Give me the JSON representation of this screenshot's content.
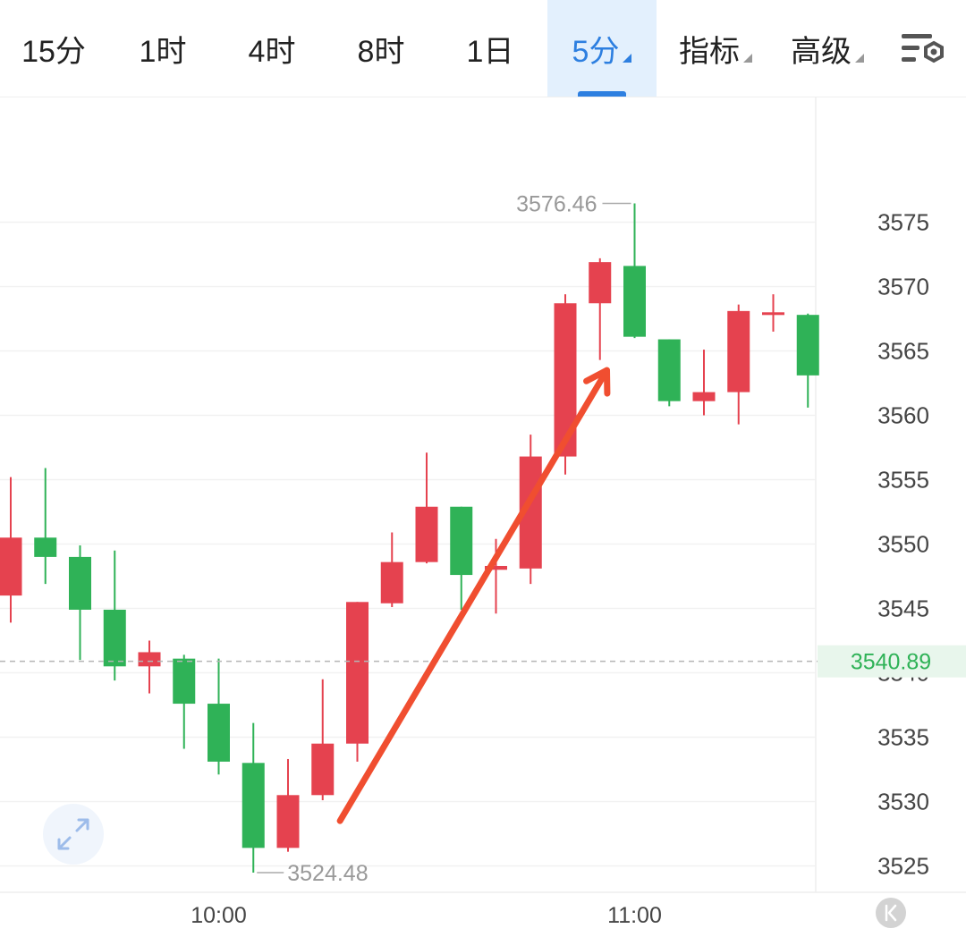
{
  "toolbar": {
    "tabs": [
      {
        "label": "15分",
        "active": false,
        "dropdown": false
      },
      {
        "label": "1时",
        "active": false,
        "dropdown": false
      },
      {
        "label": "4时",
        "active": false,
        "dropdown": false
      },
      {
        "label": "8时",
        "active": false,
        "dropdown": false
      },
      {
        "label": "1日",
        "active": false,
        "dropdown": false
      },
      {
        "label": "5分",
        "active": true,
        "dropdown": true
      },
      {
        "label": "指标",
        "active": false,
        "dropdown": true
      },
      {
        "label": "高级",
        "active": false,
        "dropdown": true
      }
    ],
    "settings_icon": "chart-settings-icon"
  },
  "colors": {
    "up": "#e5424f",
    "down": "#2fb257",
    "accent": "#2d7fe0",
    "current_price": "#2fb257",
    "arrow": "#f04e30"
  },
  "chart_data": {
    "type": "candlestick",
    "interval": "5分",
    "y_ticks": [
      3525,
      3530,
      3535,
      3540,
      3545,
      3550,
      3555,
      3560,
      3565,
      3570,
      3575
    ],
    "ylim": [
      3523,
      3578
    ],
    "x_labels": [
      {
        "index": 6,
        "label": "10:00"
      },
      {
        "index": 18,
        "label": "11:00"
      }
    ],
    "candles": [
      {
        "open": 3546.0,
        "close": 3550.5,
        "high": 3555.2,
        "low": 3543.9
      },
      {
        "open": 3550.5,
        "close": 3549.0,
        "high": 3555.9,
        "low": 3546.9
      },
      {
        "open": 3549.0,
        "close": 3544.9,
        "high": 3549.9,
        "low": 3541.0
      },
      {
        "open": 3544.9,
        "close": 3540.5,
        "high": 3549.5,
        "low": 3539.4
      },
      {
        "open": 3540.5,
        "close": 3541.6,
        "high": 3542.5,
        "low": 3538.4
      },
      {
        "open": 3541.1,
        "close": 3537.6,
        "high": 3541.4,
        "low": 3534.1
      },
      {
        "open": 3537.6,
        "close": 3533.1,
        "high": 3541.1,
        "low": 3532.1
      },
      {
        "open": 3533.0,
        "close": 3526.4,
        "high": 3536.1,
        "low": 3524.48
      },
      {
        "open": 3526.4,
        "close": 3530.5,
        "high": 3533.3,
        "low": 3526.1
      },
      {
        "open": 3530.5,
        "close": 3534.5,
        "high": 3539.5,
        "low": 3530.1
      },
      {
        "open": 3534.5,
        "close": 3545.5,
        "high": 3545.5,
        "low": 3533.1
      },
      {
        "open": 3545.4,
        "close": 3548.6,
        "high": 3550.9,
        "low": 3545.1
      },
      {
        "open": 3548.6,
        "close": 3552.9,
        "high": 3557.1,
        "low": 3548.5
      },
      {
        "open": 3552.9,
        "close": 3547.6,
        "high": 3552.9,
        "low": 3544.9
      },
      {
        "open": 3548.0,
        "close": 3548.3,
        "high": 3550.4,
        "low": 3544.6
      },
      {
        "open": 3548.1,
        "close": 3556.8,
        "high": 3558.5,
        "low": 3546.9
      },
      {
        "open": 3556.8,
        "close": 3568.7,
        "high": 3569.4,
        "low": 3555.4
      },
      {
        "open": 3568.7,
        "close": 3571.9,
        "high": 3572.2,
        "low": 3564.3
      },
      {
        "open": 3571.6,
        "close": 3566.1,
        "high": 3576.46,
        "low": 3566.0
      },
      {
        "open": 3565.9,
        "close": 3561.1,
        "high": 3565.9,
        "low": 3560.7
      },
      {
        "open": 3561.1,
        "close": 3561.8,
        "high": 3565.1,
        "low": 3560.0
      },
      {
        "open": 3561.8,
        "close": 3568.1,
        "high": 3568.6,
        "low": 3559.3
      },
      {
        "open": 3567.9,
        "close": 3568.0,
        "high": 3569.4,
        "low": 3566.5
      },
      {
        "open": 3567.8,
        "close": 3563.1,
        "high": 3567.9,
        "low": 3560.6
      }
    ],
    "current_price": 3540.89,
    "current_price_label": "3540.89",
    "max_label": {
      "index": 18,
      "value": 3576.46,
      "text": "3576.46"
    },
    "min_label": {
      "index": 7,
      "value": 3524.48,
      "text": "3524.48"
    },
    "annotation": {
      "type": "arrow",
      "from": {
        "index": 9.5,
        "value": 3528.5
      },
      "to": {
        "index": 17.2,
        "value": 3563.5
      }
    }
  }
}
